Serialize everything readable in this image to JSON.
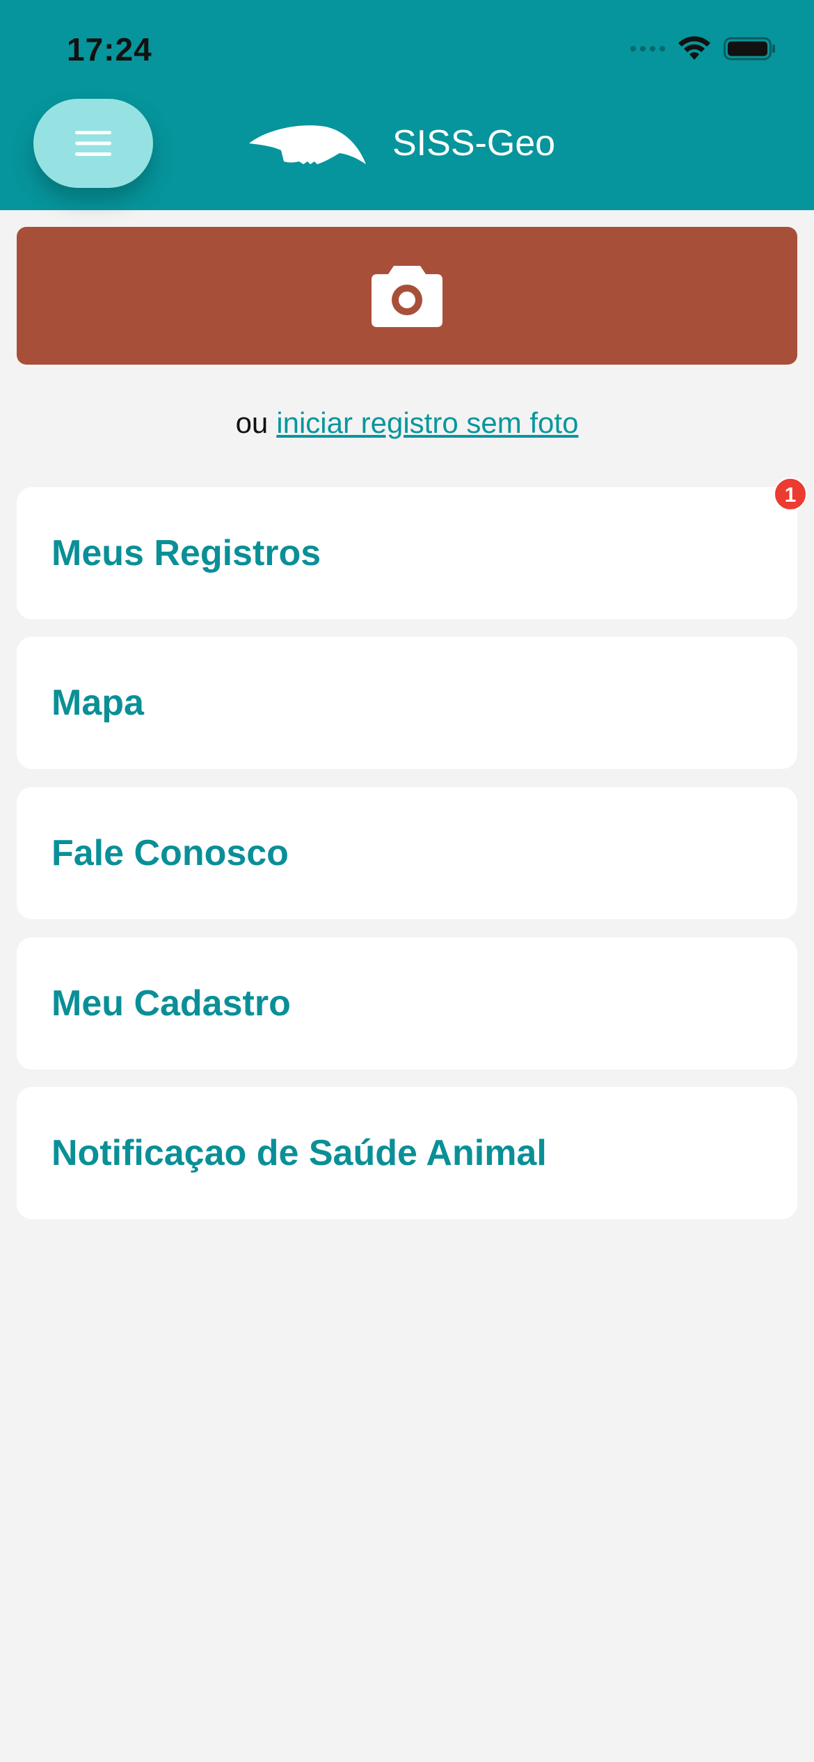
{
  "status_bar": {
    "time": "17:24"
  },
  "header": {
    "title": "SISS-Geo",
    "background_color": "#06959c",
    "menu_icon": "hamburger-icon",
    "logo_icon": "anteater-logo-icon"
  },
  "camera": {
    "icon": "camera-icon",
    "background_color": "#a84f3a"
  },
  "alternative": {
    "prefix": "ou",
    "link_text": "iniciar registro sem foto"
  },
  "menu": {
    "items": [
      {
        "label": "Meus Registros"
      },
      {
        "label": "Mapa"
      },
      {
        "label": "Fale Conosco"
      },
      {
        "label": "Meu Cadastro"
      },
      {
        "label": "Notificaçao de Saúde Animal"
      }
    ],
    "badge_count": "1"
  },
  "colors": {
    "accent": "#0a8f97",
    "badge": "#ec3b30",
    "page_background": "#f3f3f3"
  }
}
